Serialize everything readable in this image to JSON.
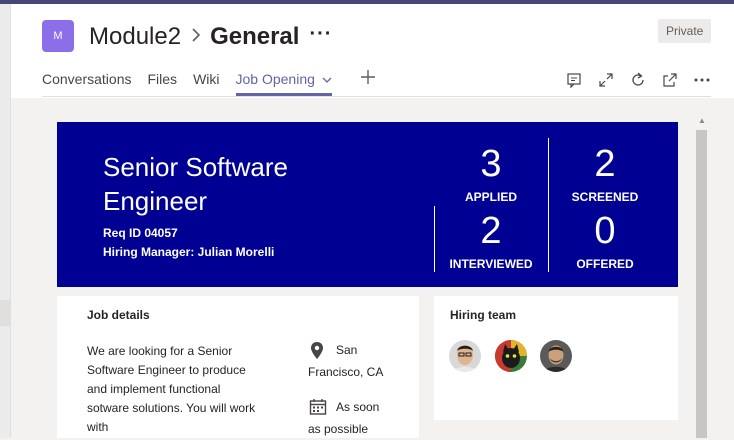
{
  "app": {
    "team_initial": "M",
    "team_name": "Module2",
    "channel_name": "General",
    "privacy_badge": "Private",
    "breadcrumb_separator": ">"
  },
  "tabs": [
    {
      "label": "Conversations",
      "active": false
    },
    {
      "label": "Files",
      "active": false
    },
    {
      "label": "Wiki",
      "active": false
    },
    {
      "label": "Job Opening",
      "active": true
    }
  ],
  "header_icons": [
    "chat-icon",
    "expand-icon",
    "refresh-icon",
    "popout-icon",
    "more-icon"
  ],
  "job": {
    "title": "Senior Software Engineer",
    "req_id": "Req ID 04057",
    "hiring_manager": "Hiring Manager: Julian Morelli",
    "stats": [
      {
        "value": "3",
        "label": "APPLIED"
      },
      {
        "value": "2",
        "label": "SCREENED"
      },
      {
        "value": "2",
        "label": "INTERVIEWED"
      },
      {
        "value": "0",
        "label": "OFFERED"
      }
    ]
  },
  "job_details": {
    "heading": "Job details",
    "description": "We are looking for a Senior Software Engineer to produce and implement functional sotware solutions. You will work with",
    "location": "San Francisco, CA",
    "start": "As soon as possible"
  },
  "hiring_team": {
    "heading": "Hiring team",
    "members": [
      "hiring-team-member-1",
      "hiring-team-member-2",
      "hiring-team-member-3"
    ]
  },
  "colors": {
    "brand": "#6264a7",
    "hero_bg": "#000092",
    "team_avatar": "#8b6ee8"
  }
}
